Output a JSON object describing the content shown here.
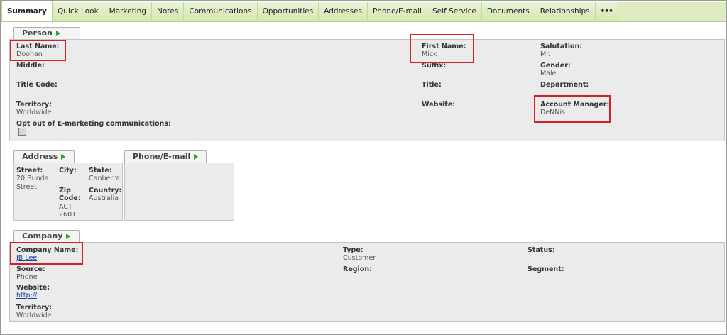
{
  "tabs": [
    {
      "label": "Summary",
      "active": true
    },
    {
      "label": "Quick Look"
    },
    {
      "label": "Marketing"
    },
    {
      "label": "Notes"
    },
    {
      "label": "Communications"
    },
    {
      "label": "Opportunities"
    },
    {
      "label": "Addresses"
    },
    {
      "label": "Phone/E-mail"
    },
    {
      "label": "Self Service"
    },
    {
      "label": "Documents"
    },
    {
      "label": "Relationships"
    },
    {
      "label": "•••"
    }
  ],
  "person": {
    "header": "Person",
    "last_name_label": "Last Name:",
    "last_name": "Doohan",
    "middle_label": "Middle:",
    "title_code_label": "Title Code:",
    "territory_label": "Territory:",
    "territory": "Worldwide",
    "opt_out_label": "Opt out of E-marketing communications:",
    "first_name_label": "First Name:",
    "first_name": "Mick",
    "suffix_label": "Suffix:",
    "title_label": "Title:",
    "website_label": "Website:",
    "salutation_label": "Salutation:",
    "salutation": "Mr.",
    "gender_label": "Gender:",
    "gender": "Male",
    "department_label": "Department:",
    "account_manager_label": "Account Manager:",
    "account_manager": "DeNNis"
  },
  "address": {
    "header": "Address",
    "street_label": "Street:",
    "street_line1": "20 Bunda",
    "street_line2": "Street",
    "city_label": "City:",
    "zip_label_line1": "Zip",
    "zip_label_line2": "Code:",
    "zip_line1": "ACT",
    "zip_line2": "2601",
    "state_label": "State:",
    "state": "Canberra",
    "country_label": "Country:",
    "country": "Australia"
  },
  "phone": {
    "header": "Phone/E-mail"
  },
  "company": {
    "header": "Company",
    "company_name_label": "Company Name:",
    "company_name": "JB Lee",
    "source_label": "Source:",
    "source": "Phone",
    "website_label": "Website:",
    "website": "http://",
    "territory_label": "Territory:",
    "territory": "Worldwide",
    "type_label": "Type:",
    "type": "Customer",
    "region_label": "Region:",
    "status_label": "Status:",
    "segment_label": "Segment:"
  },
  "colors": {
    "highlight": "#d0222a",
    "arrow": "#2e9e2e",
    "tabbar": "#dcebc0"
  }
}
